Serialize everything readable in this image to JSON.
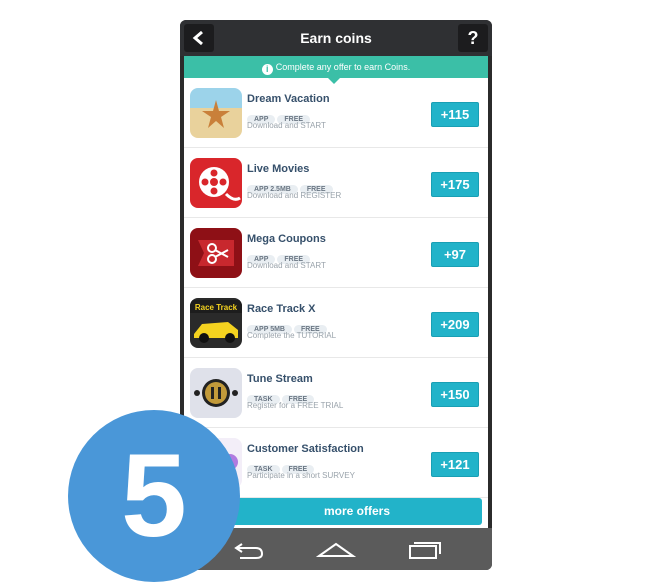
{
  "header": {
    "title": "Earn coins",
    "back_icon": "chevron-left-icon",
    "help_label": "?"
  },
  "banner": {
    "icon_label": "i",
    "text": "Complete any offer to earn Coins."
  },
  "offers": [
    {
      "name": "Dream Vacation",
      "tags": [
        "APP",
        "FREE"
      ],
      "desc": "Download and START",
      "coins": "+115",
      "icon": "starfish-beach-icon"
    },
    {
      "name": "Live Movies",
      "tags": [
        "APP 2.5MB",
        "FREE"
      ],
      "desc": "Download and REGISTER",
      "coins": "+175",
      "icon": "film-reel-icon"
    },
    {
      "name": "Mega Coupons",
      "tags": [
        "APP",
        "FREE"
      ],
      "desc": "Download and START",
      "coins": "+97",
      "icon": "scissors-coupon-icon"
    },
    {
      "name": "Race Track X",
      "tags": [
        "APP 5MB",
        "FREE"
      ],
      "desc": "Complete the TUTORIAL",
      "coins": "+209",
      "icon": "race-car-icon",
      "icon_text": "Race Track"
    },
    {
      "name": "Tune Stream",
      "tags": [
        "TASK",
        "FREE"
      ],
      "desc": "Register for a FREE TRIAL",
      "coins": "+150",
      "icon": "pause-player-icon"
    },
    {
      "name": "Customer Satisfaction",
      "tags": [
        "TASK",
        "FREE"
      ],
      "desc": "Participate in a short SURVEY",
      "coins": "+121",
      "icon": "survey-icon"
    }
  ],
  "more_offers_label": "more offers",
  "navbar": {
    "back": "back-icon",
    "home": "home-icon",
    "recents": "recents-icon"
  },
  "step_badge": "5",
  "colors": {
    "header": "#2f3033",
    "banner": "#3bbfa7",
    "accent": "#22b3c9",
    "badge": "#4a97d8",
    "name": "#36506b"
  }
}
